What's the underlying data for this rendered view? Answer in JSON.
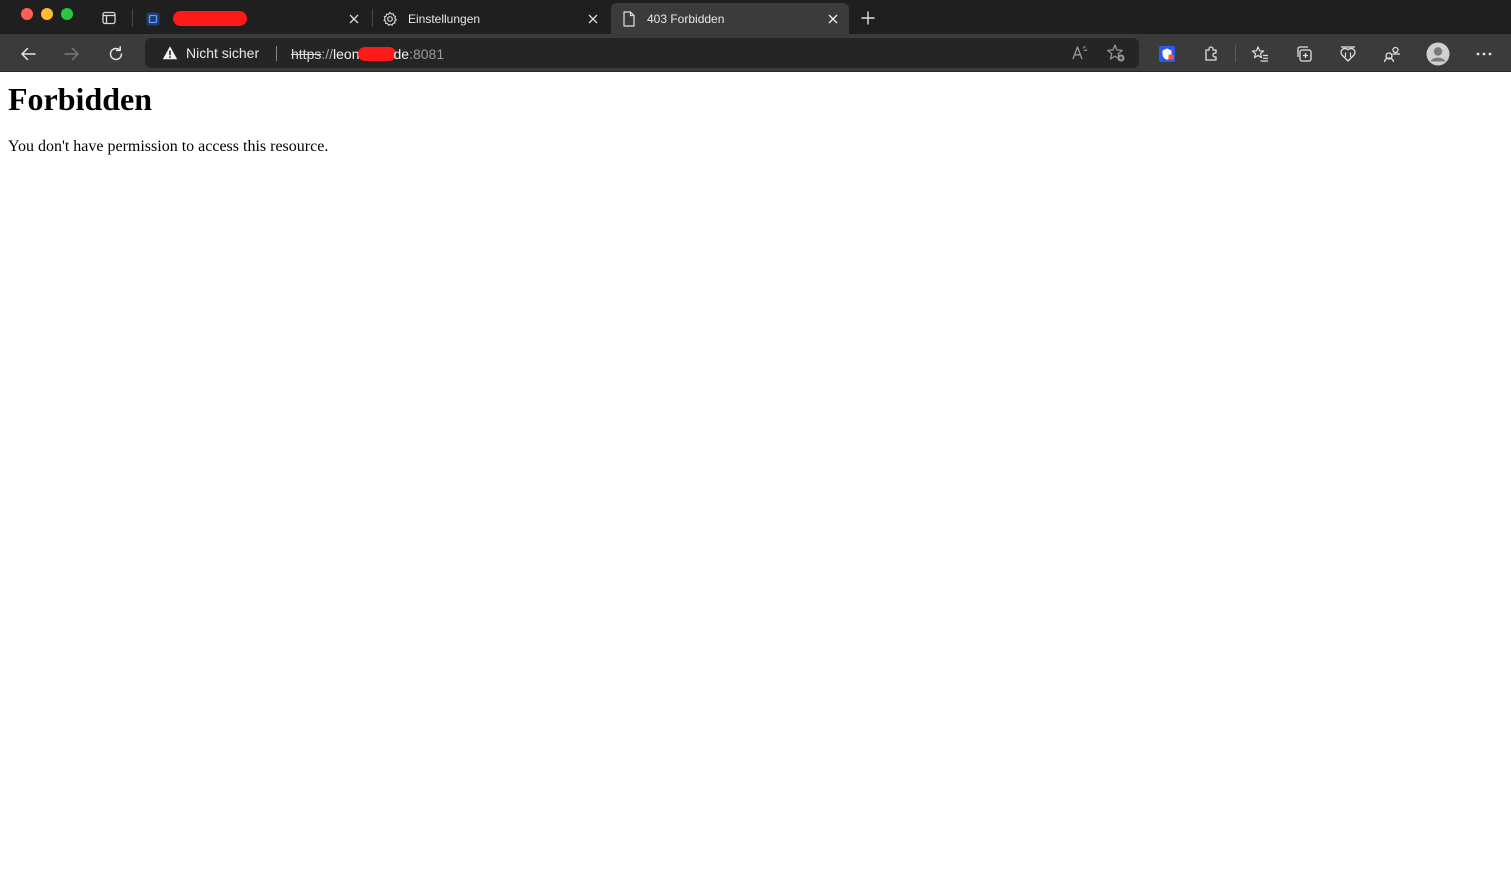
{
  "browser": {
    "tabs": [
      {
        "title": "",
        "favicon": "blue-square-app-icon",
        "redacted": true,
        "active": false
      },
      {
        "title": "Einstellungen",
        "favicon": "gear-icon",
        "active": false
      },
      {
        "title": "403 Forbidden",
        "favicon": "document-icon",
        "active": true
      }
    ],
    "address_bar": {
      "security_label": "Nicht sicher",
      "url_scheme": "https",
      "url_separator": "://",
      "url_host_start": "leon",
      "url_host_end": "de",
      "url_port": ":8081"
    },
    "colors": {
      "titlebar": "#1f1f1f",
      "toolbar": "#3b3b3b",
      "address_bar": "#252525",
      "redaction": "#ff1a1a"
    }
  },
  "page": {
    "heading": "Forbidden",
    "message": "You don't have permission to access this resource."
  }
}
